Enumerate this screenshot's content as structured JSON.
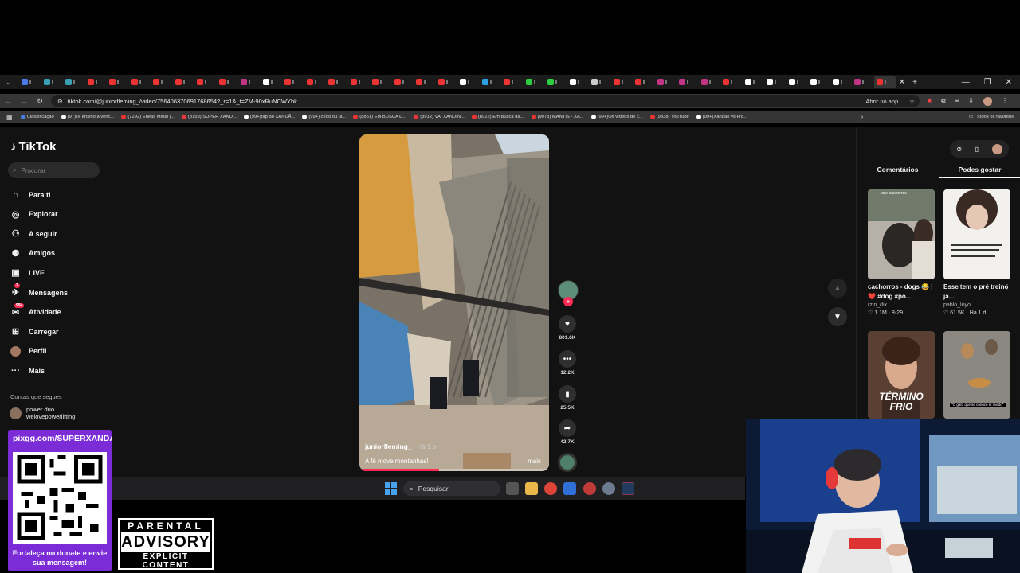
{
  "browser": {
    "url": "tiktok.com/@juniorfleming_/video/756406370691768654?_r=1&_t=ZM-90xRuNCWYbk",
    "open_app_label": "Abrir no app",
    "bookmarks": [
      {
        "label": "Classificação",
        "kind": "blue"
      },
      {
        "label": "(97)Te ensino a venc...",
        "kind": "tk"
      },
      {
        "label": "(7292) Enéas Metal |...",
        "kind": "yt"
      },
      {
        "label": "(8159) SUPER XAND...",
        "kind": "yt"
      },
      {
        "label": "(99+)rap do XANDÃ...",
        "kind": "tk"
      },
      {
        "label": "(99+) cedo ou já...",
        "kind": "tk"
      },
      {
        "label": "(8851) EM BUSCA D...",
        "kind": "yt"
      },
      {
        "label": "(8912) VAI XANDIN...",
        "kind": "yt"
      },
      {
        "label": "(8912) Em Busca da...",
        "kind": "yt"
      },
      {
        "label": "(9078) MANTIS - XA...",
        "kind": "yt"
      },
      {
        "label": "(99+)Os vídeos de c...",
        "kind": "tk"
      },
      {
        "label": "(9338) YouTube",
        "kind": "yt"
      },
      {
        "label": "(99+)Xandão vs Fra...",
        "kind": "tk"
      }
    ],
    "all_favorites_label": "Todos os favoritos"
  },
  "tiktok": {
    "logo": "TikTok",
    "search_placeholder": "Procurar",
    "nav": [
      {
        "label": "Para ti",
        "icon": "home-icon"
      },
      {
        "label": "Explorar",
        "icon": "compass-icon"
      },
      {
        "label": "A seguir",
        "icon": "following-icon"
      },
      {
        "label": "Amigos",
        "icon": "friends-icon"
      },
      {
        "label": "LIVE",
        "icon": "live-icon"
      },
      {
        "label": "Mensagens",
        "icon": "messages-icon",
        "badge": "2"
      },
      {
        "label": "Atividade",
        "icon": "activity-icon",
        "badge": "99+"
      },
      {
        "label": "Carregar",
        "icon": "upload-icon"
      },
      {
        "label": "Perfil",
        "icon": "profile-avatar"
      },
      {
        "label": "Mais",
        "icon": "more-icon"
      }
    ],
    "follows_title": "Contas que segues",
    "follows": [
      {
        "name": "power duo",
        "handle": "welovepowerlifting"
      }
    ],
    "video": {
      "author": "juniorfleming_",
      "when": "Há 1 s",
      "caption": "A fé move montanhas!",
      "more": "mais",
      "progress": 0.42
    },
    "actions": {
      "likes": "801.6K",
      "comments": "12.2K",
      "saves": "25.5K",
      "shares": "42.7K"
    },
    "right_tabs": [
      "Comentários",
      "Podes gostar"
    ],
    "recommended": [
      {
        "title": "cachorros - dogs 😂❤️ #dog #po...",
        "author": "rzin_dix",
        "likes": "1.1M",
        "date": "8-29",
        "overlay": "pov: cachorros"
      },
      {
        "title": "Esse tem o pré treino já...",
        "author": "pablo_loyo",
        "likes": "61.5K",
        "date": "Há 1 d",
        "overlay": ""
      },
      {
        "title": "",
        "author": "",
        "likes": "",
        "date": "",
        "overlay": "TÉRMINO FRIO"
      },
      {
        "title": "",
        "author": "",
        "likes": "",
        "date": "",
        "overlay": "\"O gato que se conoce el miedo\""
      }
    ]
  },
  "taskbar": {
    "search_placeholder": "Pesquisar"
  },
  "stream": {
    "qr_url": "pixgg.com/SUPERXANDAO",
    "qr_caption": "Fortaleça no donate e envie sua mensagem!",
    "advisory_top": "PARENTAL",
    "advisory_mid": "ADVISORY",
    "advisory_bottom": "EXPLICIT CONTENT"
  },
  "colors": {
    "tiktok_accent": "#fe2c55",
    "qr_panel": "#7b2cd6",
    "page_bg": "#121212"
  }
}
